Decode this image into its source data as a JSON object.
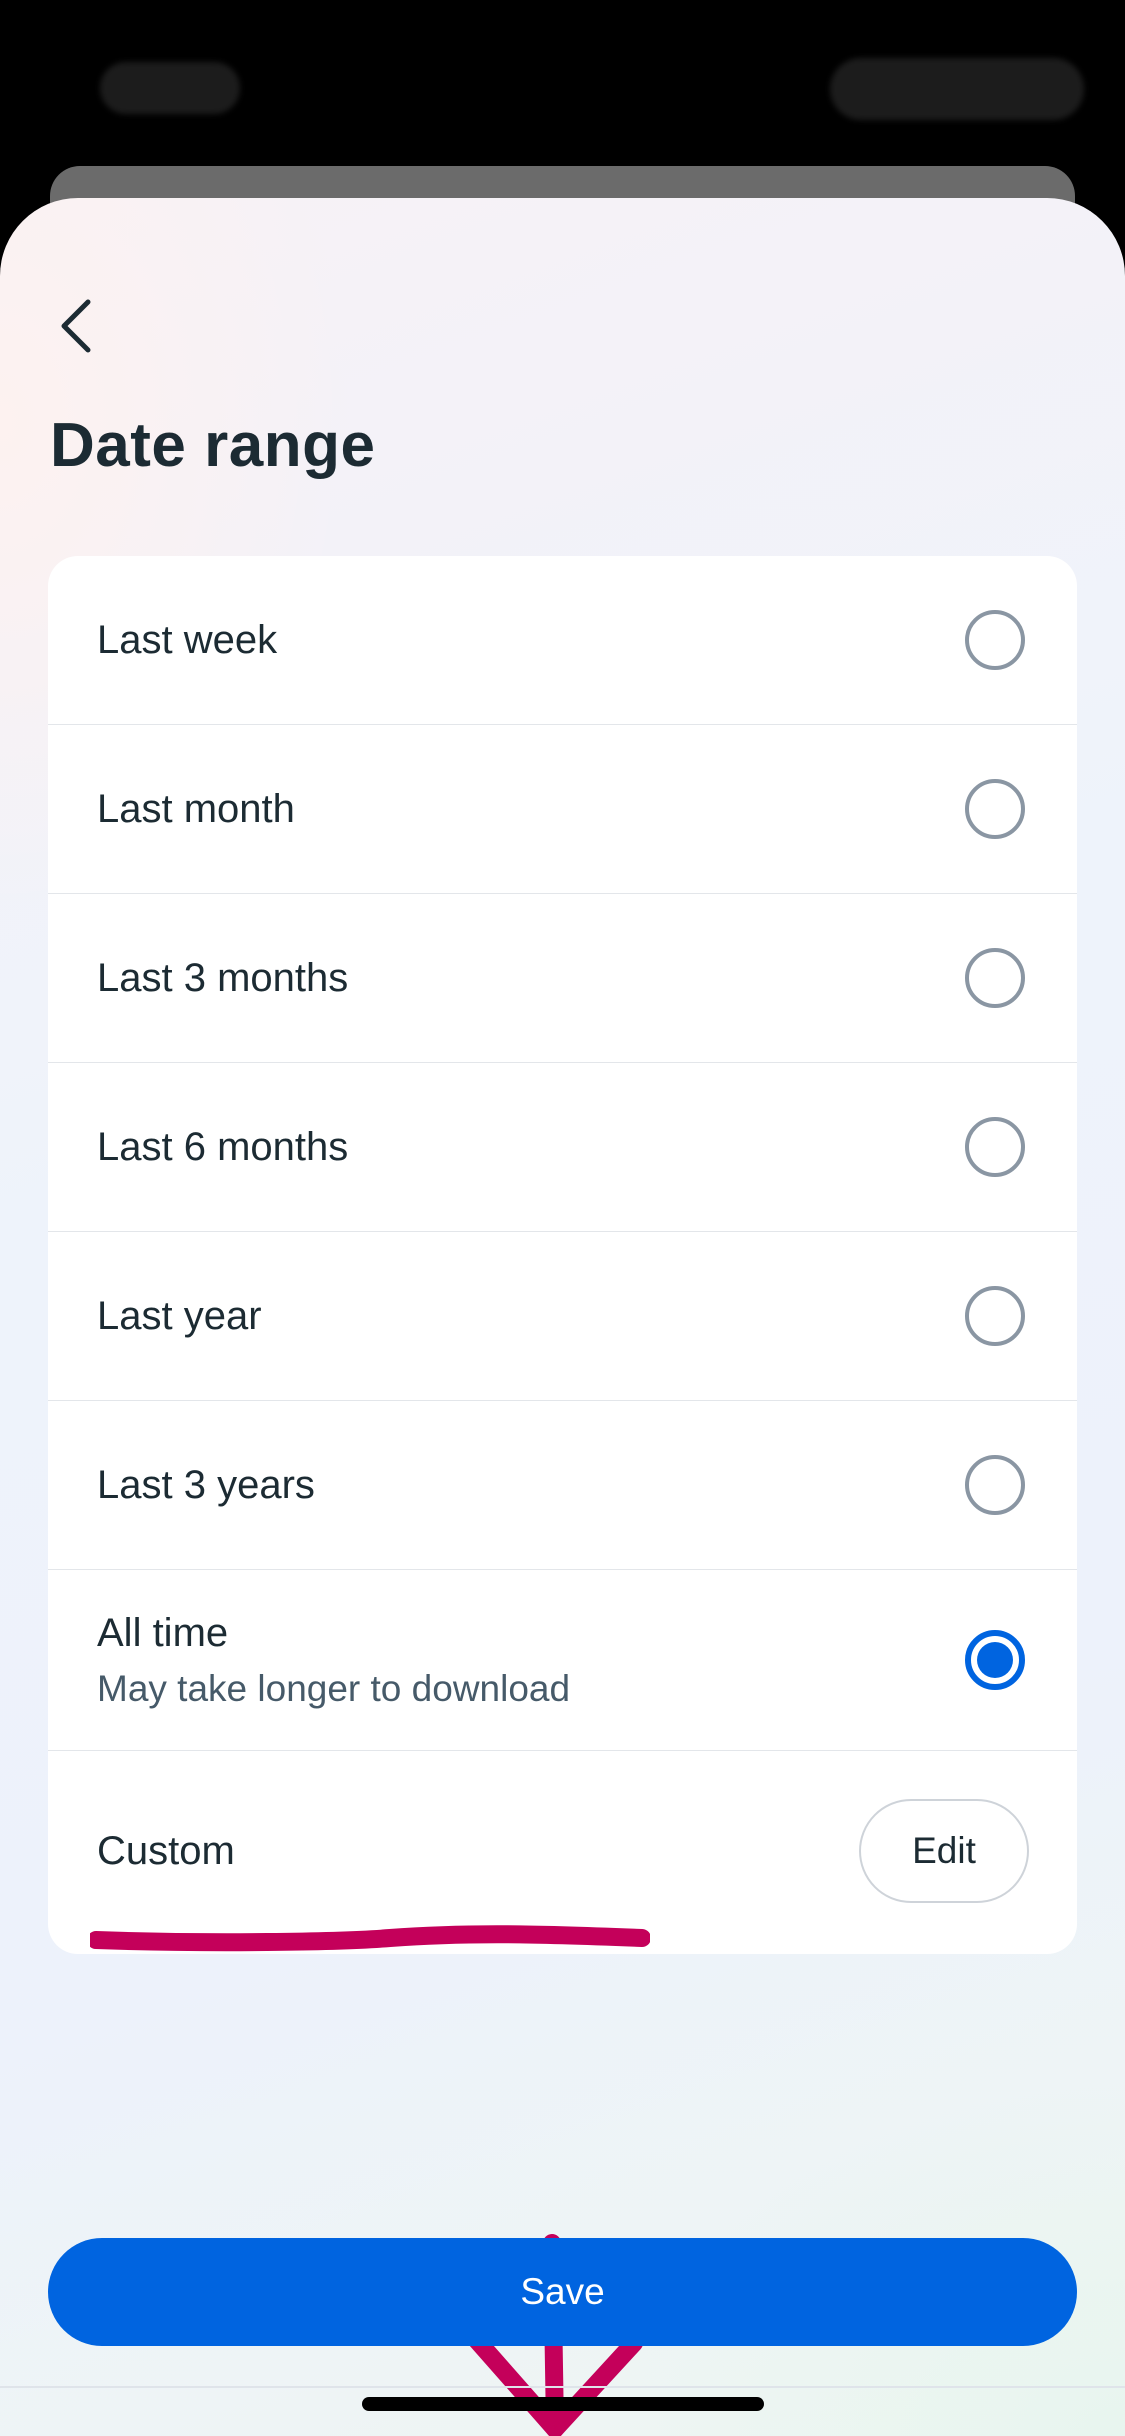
{
  "header": {
    "back_icon": "chevron-left-icon",
    "title": "Date range"
  },
  "options": [
    {
      "label": "Last week",
      "selected": false
    },
    {
      "label": "Last month",
      "selected": false
    },
    {
      "label": "Last 3 months",
      "selected": false
    },
    {
      "label": "Last 6 months",
      "selected": false
    },
    {
      "label": "Last year",
      "selected": false
    },
    {
      "label": "Last 3 years",
      "selected": false
    },
    {
      "label": "All time",
      "sublabel": "May take longer to download",
      "selected": true
    }
  ],
  "custom": {
    "label": "Custom",
    "edit_label": "Edit"
  },
  "footer": {
    "save_label": "Save"
  },
  "colors": {
    "accent": "#0064e0",
    "annotation": "#c4005a",
    "text_primary": "#1c2b33",
    "text_secondary": "#465a69"
  }
}
